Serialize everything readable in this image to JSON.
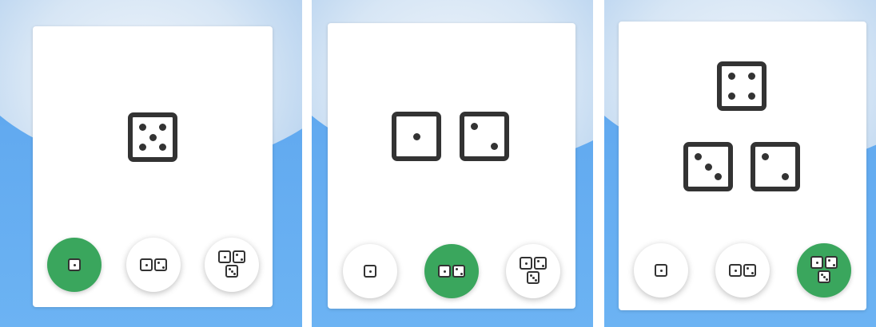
{
  "colors": {
    "accent": "#3aa65d",
    "die": "#333333",
    "background": "#62aaf0"
  },
  "icons": {
    "one_die": "single-die-icon",
    "two_dice": "two-dice-icon",
    "three_dice": "three-dice-icon"
  },
  "screens": [
    {
      "dice_values": [
        5
      ],
      "selected_mode": "one-die"
    },
    {
      "dice_values": [
        1,
        2
      ],
      "selected_mode": "two-dice"
    },
    {
      "dice_values": [
        4,
        3,
        2
      ],
      "selected_mode": "three-dice"
    }
  ],
  "mode_buttons": [
    "one-die",
    "two-dice",
    "three-dice"
  ]
}
